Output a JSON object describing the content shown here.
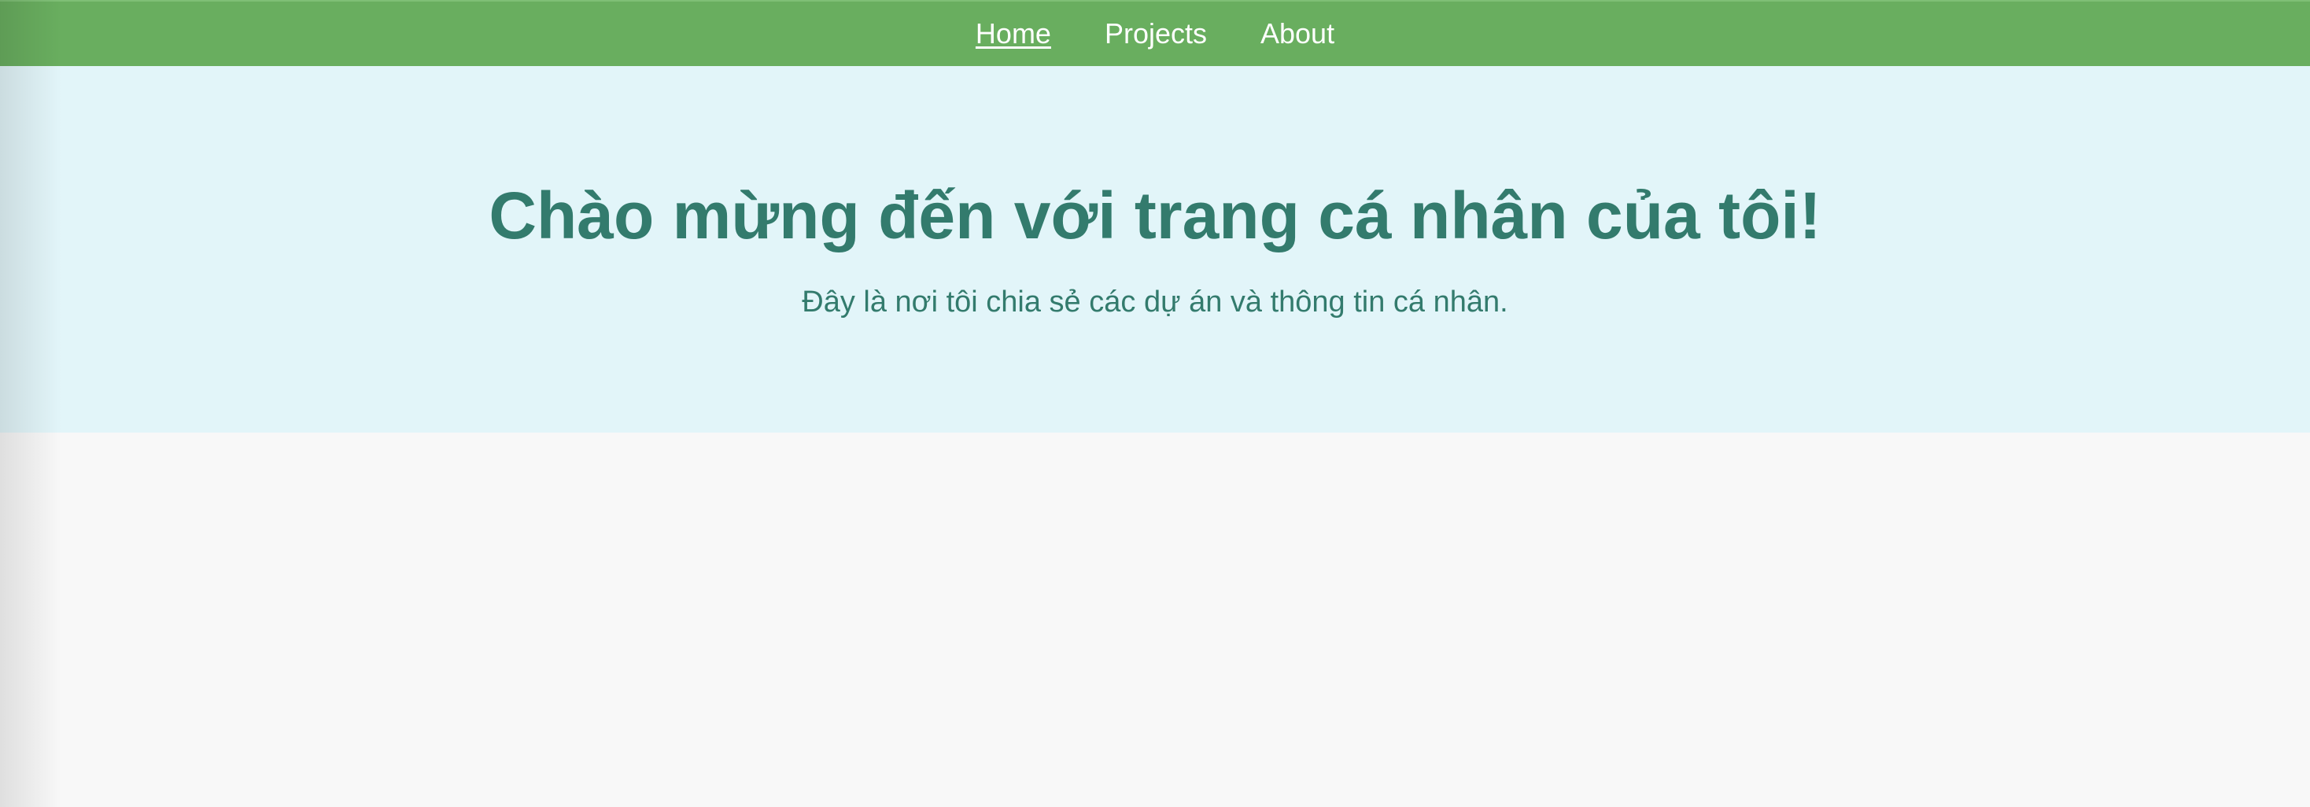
{
  "nav": {
    "links": [
      {
        "label": "Home",
        "active": true
      },
      {
        "label": "Projects",
        "active": false
      },
      {
        "label": "About",
        "active": false
      }
    ]
  },
  "hero": {
    "title": "Chào mừng đến với trang cá nhân của tôi!",
    "subtitle": "Đây là nơi tôi chia sẻ các dự án và thông tin cá nhân."
  },
  "colors": {
    "nav_background": "#69ae5f",
    "hero_background": "#e2f5f9",
    "hero_text": "#337b6d",
    "page_background": "#f8f8f8"
  }
}
